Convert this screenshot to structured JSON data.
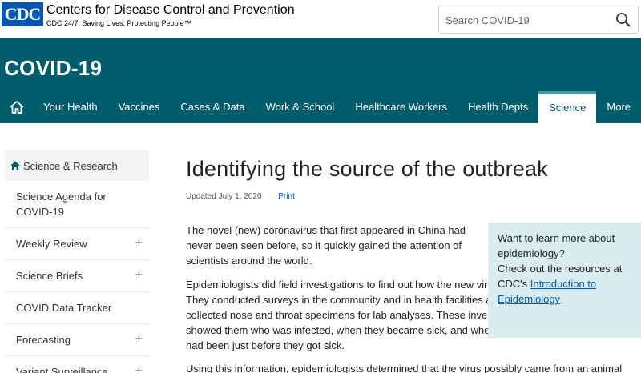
{
  "header": {
    "logo": "CDC",
    "org_name": "Centers for Disease Control and Prevention",
    "tagline": "CDC 24/7: Saving Lives, Protecting People™",
    "search_placeholder": "Search COVID-19"
  },
  "banner": {
    "title": "COVID-19"
  },
  "nav": {
    "items": [
      {
        "label": "Your Health"
      },
      {
        "label": "Vaccines"
      },
      {
        "label": "Cases & Data"
      },
      {
        "label": "Work & School"
      },
      {
        "label": "Healthcare Workers"
      },
      {
        "label": "Health Depts"
      },
      {
        "label": "Science",
        "active": true
      },
      {
        "label": "More"
      }
    ]
  },
  "sidebar": {
    "header": "Science & Research",
    "items": [
      {
        "label": "Science Agenda for COVID-19"
      },
      {
        "label": "Weekly Review",
        "expand": "+"
      },
      {
        "label": "Science Briefs",
        "expand": "+"
      },
      {
        "label": "COVID Data Tracker"
      },
      {
        "label": "Forecasting",
        "expand": "+"
      },
      {
        "label": "Variant Surveillance",
        "expand": "+"
      }
    ]
  },
  "main": {
    "title": "Identifying the source of the outbreak",
    "updated": "Updated July 1, 2020",
    "print": "Print",
    "paragraphs": [
      "The novel (new) coronavirus that first appeared in China had never been seen before, so it quickly gained the attention of scientists around the world.",
      "Epidemiologists did field investigations to find out how the new virus started. They conducted surveys in the community and in health facilities and collected nose and throat specimens for lab analyses. These investigations showed them who was infected, when they became sick, and where they had been just before they got sick.",
      "Using this information, epidemiologists determined that the virus possibly came from an animal"
    ]
  },
  "callout": {
    "line1": "Want to learn more about epidemiology?",
    "line2": "Check out the resources at CDC's ",
    "link": "Introduction to Epidemiology"
  },
  "colors": {
    "brand_teal": "#005e6c",
    "cdc_blue": "#0057b7",
    "callout_bg": "#d9ecf0"
  }
}
